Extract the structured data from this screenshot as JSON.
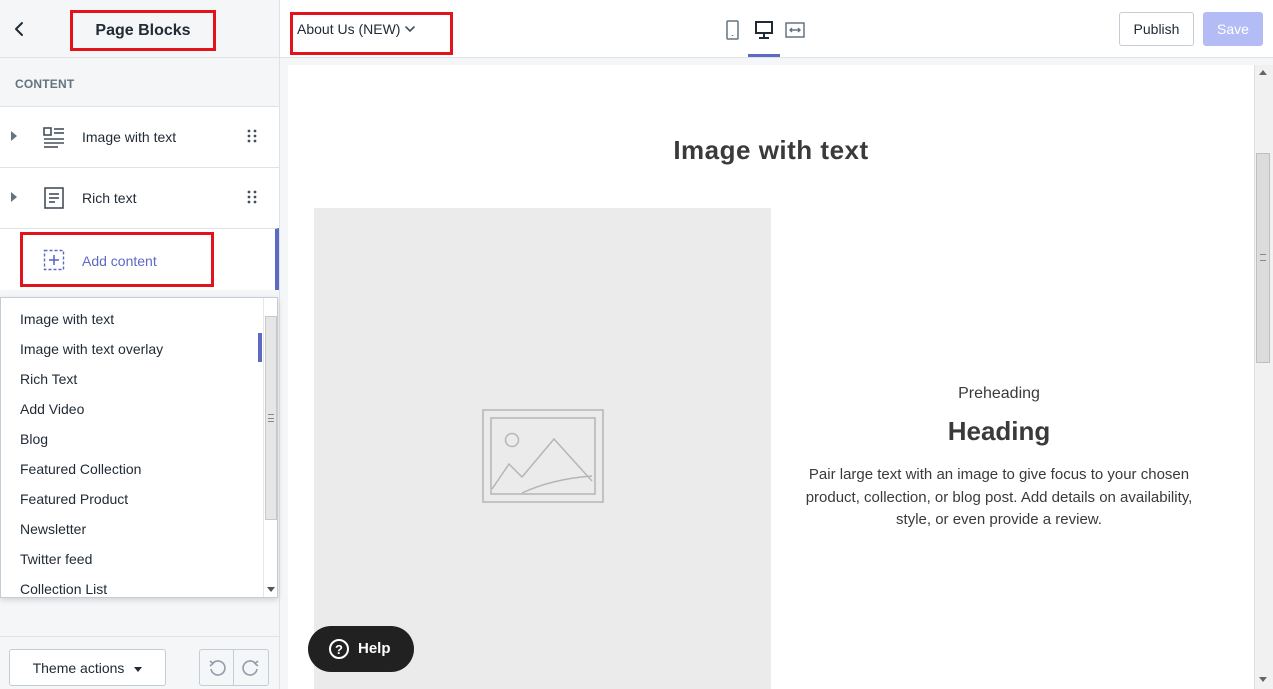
{
  "sidebar": {
    "title": "Page Blocks",
    "section_label": "CONTENT",
    "blocks": [
      {
        "label": "Image with text",
        "icon": "image-with-text-icon"
      },
      {
        "label": "Rich text",
        "icon": "rich-text-icon"
      }
    ],
    "add_content_label": "Add content"
  },
  "content_menu": {
    "items": [
      "Image with text",
      "Image with text overlay",
      "Rich Text",
      "Add Video",
      "Blog",
      "Featured Collection",
      "Featured Product",
      "Newsletter",
      "Twitter feed",
      "Collection List"
    ],
    "highlighted_item": "Image with text overlay"
  },
  "footer": {
    "theme_actions_label": "Theme actions"
  },
  "topbar": {
    "page_selector": "About Us (NEW)",
    "active_device": "desktop",
    "publish_label": "Publish",
    "save_label": "Save"
  },
  "preview": {
    "section_title": "Image with text",
    "preheading": "Preheading",
    "heading": "Heading",
    "body": "Pair large text with an image to give focus to your chosen product, collection, or blog post. Add details on availability, style, or even provide a review."
  },
  "help": {
    "label": "Help"
  },
  "colors": {
    "accent": "#5c6ac4",
    "highlight_border": "#e3131b",
    "save_disabled": "#b3bcf5"
  }
}
